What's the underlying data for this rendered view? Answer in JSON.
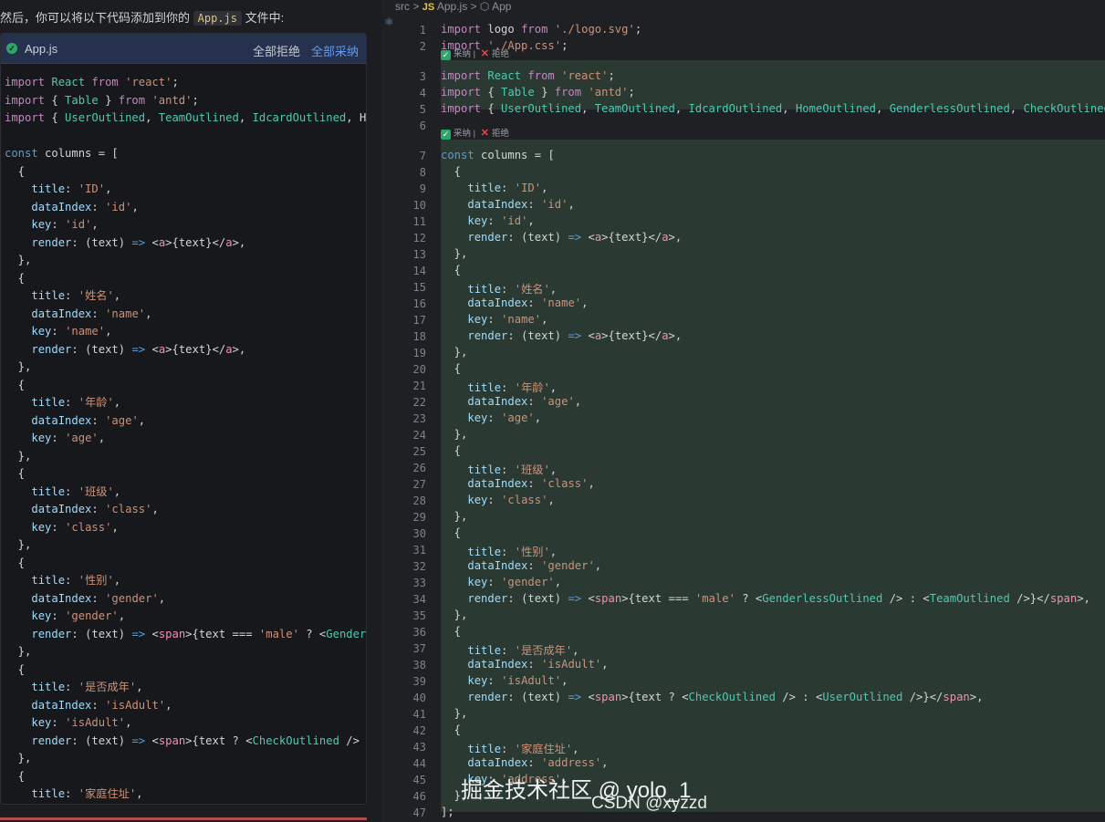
{
  "chat": {
    "intro_before": "然后，你可以将以下代码添加到你的",
    "intro_file": "App.js",
    "intro_after": "文件中:",
    "block_filename": "App.js",
    "reject_all": "全部拒绝",
    "accept_all": "全部采纳",
    "code_lines": [
      "import React from 'react';",
      "import { Table } from 'antd';",
      "import { UserOutlined, TeamOutlined, IdcardOutlined, Ho",
      "",
      "const columns = [",
      "  {",
      "    title: 'ID',",
      "    dataIndex: 'id',",
      "    key: 'id',",
      "    render: (text) => <a>{text}</a>,",
      "  },",
      "  {",
      "    title: '姓名',",
      "    dataIndex: 'name',",
      "    key: 'name',",
      "    render: (text) => <a>{text}</a>,",
      "  },",
      "  {",
      "    title: '年龄',",
      "    dataIndex: 'age',",
      "    key: 'age',",
      "  },",
      "  {",
      "    title: '班级',",
      "    dataIndex: 'class',",
      "    key: 'class',",
      "  },",
      "  {",
      "    title: '性别',",
      "    dataIndex: 'gender',",
      "    key: 'gender',",
      "    render: (text) => <span>{text === 'male' ? <Genderl",
      "  },",
      "  {",
      "    title: '是否成年',",
      "    dataIndex: 'isAdult',",
      "    key: 'isAdult',",
      "    render: (text) => <span>{text ? <CheckOutlined /> :",
      "  },",
      "  {",
      "    title: '家庭住址',"
    ]
  },
  "editor": {
    "breadcrumb": [
      "src",
      ">",
      "JS",
      "App.js",
      ">",
      "App"
    ],
    "suggest_accept": "采纳",
    "suggest_reject": "拒绝",
    "lines": [
      {
        "n": "1",
        "text": "import logo from './logo.svg';"
      },
      {
        "n": "2",
        "text": "import './App.css';"
      },
      {
        "n": "3",
        "text": "import React from 'react';"
      },
      {
        "n": "4",
        "text": "import { Table } from 'antd';"
      },
      {
        "n": "5",
        "text": "import { UserOutlined, TeamOutlined, IdcardOutlined, HomeOutlined, GenderlessOutlined, CheckOutlined"
      },
      {
        "n": "6",
        "text": ""
      },
      {
        "n": "7",
        "text": "const columns = ["
      },
      {
        "n": "8",
        "text": "  {"
      },
      {
        "n": "9",
        "text": "    title: 'ID',"
      },
      {
        "n": "10",
        "text": "    dataIndex: 'id',"
      },
      {
        "n": "11",
        "text": "    key: 'id',"
      },
      {
        "n": "12",
        "text": "    render: (text) => <a>{text}</a>,"
      },
      {
        "n": "13",
        "text": "  },"
      },
      {
        "n": "14",
        "text": "  {"
      },
      {
        "n": "15",
        "text": "    title: '姓名',"
      },
      {
        "n": "16",
        "text": "    dataIndex: 'name',"
      },
      {
        "n": "17",
        "text": "    key: 'name',"
      },
      {
        "n": "18",
        "text": "    render: (text) => <a>{text}</a>,"
      },
      {
        "n": "19",
        "text": "  },"
      },
      {
        "n": "20",
        "text": "  {"
      },
      {
        "n": "21",
        "text": "    title: '年龄',"
      },
      {
        "n": "22",
        "text": "    dataIndex: 'age',"
      },
      {
        "n": "23",
        "text": "    key: 'age',"
      },
      {
        "n": "24",
        "text": "  },"
      },
      {
        "n": "25",
        "text": "  {"
      },
      {
        "n": "26",
        "text": "    title: '班级',"
      },
      {
        "n": "27",
        "text": "    dataIndex: 'class',"
      },
      {
        "n": "28",
        "text": "    key: 'class',"
      },
      {
        "n": "29",
        "text": "  },"
      },
      {
        "n": "30",
        "text": "  {"
      },
      {
        "n": "31",
        "text": "    title: '性别',"
      },
      {
        "n": "32",
        "text": "    dataIndex: 'gender',"
      },
      {
        "n": "33",
        "text": "    key: 'gender',"
      },
      {
        "n": "34",
        "text": "    render: (text) => <span>{text === 'male' ? <GenderlessOutlined /> : <TeamOutlined />}</span>,"
      },
      {
        "n": "35",
        "text": "  },"
      },
      {
        "n": "36",
        "text": "  {"
      },
      {
        "n": "37",
        "text": "    title: '是否成年',"
      },
      {
        "n": "38",
        "text": "    dataIndex: 'isAdult',"
      },
      {
        "n": "39",
        "text": "    key: 'isAdult',"
      },
      {
        "n": "40",
        "text": "    render: (text) => <span>{text ? <CheckOutlined /> : <UserOutlined />}</span>,"
      },
      {
        "n": "41",
        "text": "  },"
      },
      {
        "n": "42",
        "text": "  {"
      },
      {
        "n": "43",
        "text": "    title: '家庭住址',"
      },
      {
        "n": "44",
        "text": "    dataIndex: 'address',"
      },
      {
        "n": "45",
        "text": "    key: 'address',"
      },
      {
        "n": "46",
        "text": "  },"
      },
      {
        "n": "47",
        "text": "];"
      }
    ]
  },
  "watermark": {
    "line1": "掘金技术社区 @ yolo_1",
    "line2": "CSDN @xyzzd"
  },
  "colors": {
    "accent": "#5b9cf8",
    "diff_bg": "#2a3a33",
    "ok_green": "#2ea56a",
    "reject_red": "#e5484d"
  }
}
